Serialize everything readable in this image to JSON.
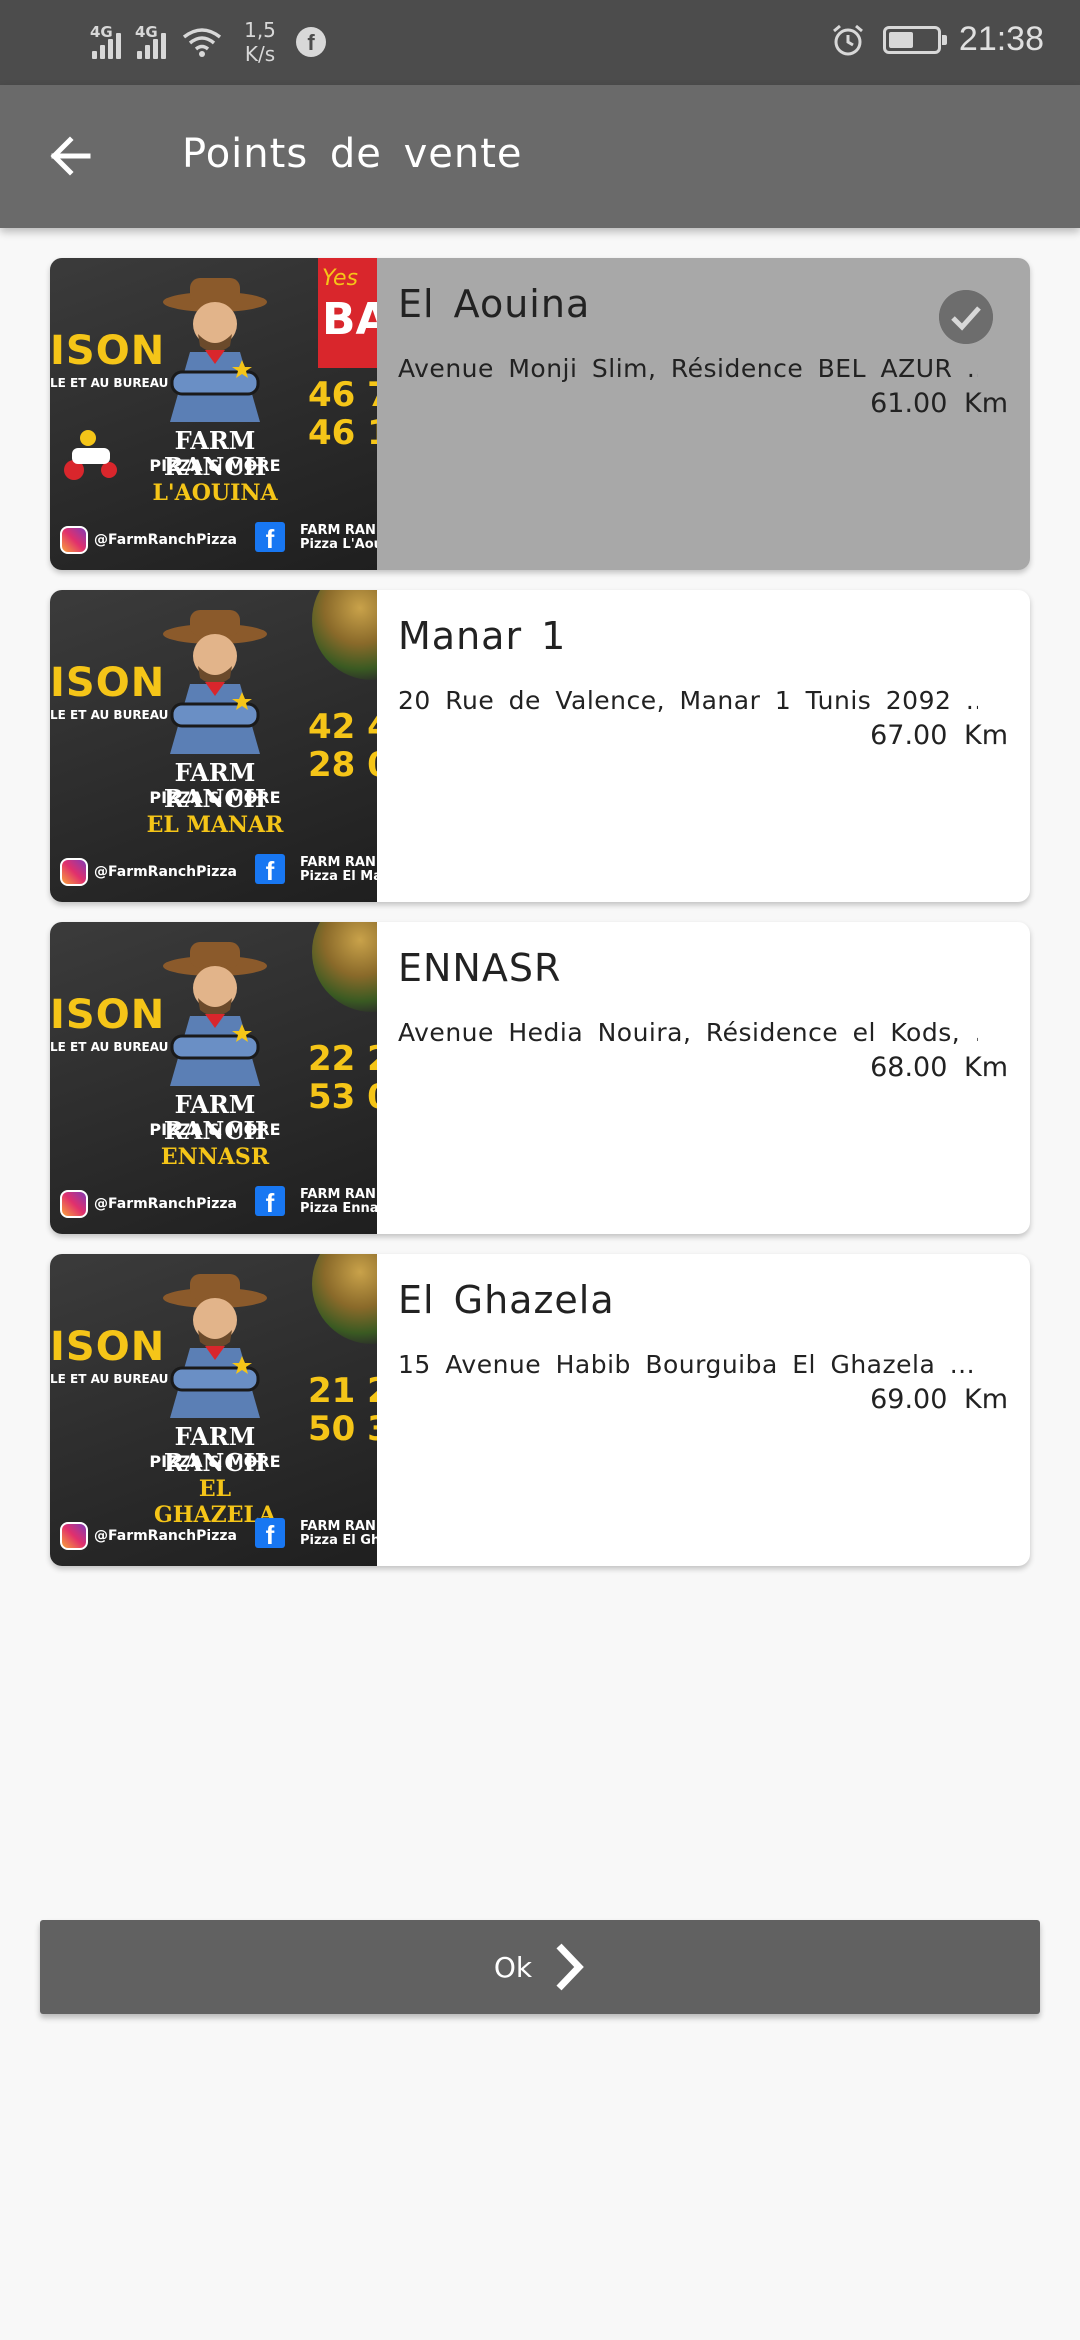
{
  "status_bar": {
    "network_1": "4G",
    "network_2": "4G",
    "speed_value": "1,5",
    "speed_unit": "K/s",
    "time": "21:38",
    "icons": [
      "signal-icon",
      "signal-icon",
      "wifi-icon",
      "facebook-icon",
      "alarm-icon",
      "battery-icon"
    ]
  },
  "appbar": {
    "title": "Points de vente",
    "back_icon": "arrow-left-icon"
  },
  "stores": [
    {
      "name": "El Aouina",
      "address": "Avenue Monji Slim, Résidence BEL AZUR ...",
      "distance": "61.00 Km",
      "selected": true,
      "thumb": {
        "left_word": "ISON",
        "left_sub": "LE ET AU BUREAU",
        "farm": "FARM RANCH",
        "pizza": "PIZZA & MORE",
        "branch": "L'AOUINA",
        "phone_1": "46 7",
        "phone_2": "46 1",
        "insta": "@FarmRanchPizza",
        "fb_1": "FARM RAN",
        "fb_2": "Pizza L'Aou",
        "banner_1": "Yes",
        "banner_2": "BA"
      }
    },
    {
      "name": "Manar 1",
      "address": "20 Rue de Valence, Manar 1 Tunis 2092 ...",
      "distance": "67.00 Km",
      "selected": false,
      "thumb": {
        "left_word": "ISON",
        "left_sub": "LE ET AU BUREAU",
        "farm": "FARM RANCH",
        "pizza": "PIZZA & MORE",
        "branch": "EL MANAR",
        "phone_1": "42 4",
        "phone_2": "28 0",
        "insta": "@FarmRanchPizza",
        "fb_1": "FARM RAN",
        "fb_2": "Pizza El Ma"
      }
    },
    {
      "name": "ENNASR",
      "address": "Avenue Hedia Nouira, Résidence el Kods, ...",
      "distance": "68.00 Km",
      "selected": false,
      "thumb": {
        "left_word": "ISON",
        "left_sub": "LE ET AU BUREAU",
        "farm": "FARM RANCH",
        "pizza": "PIZZA & MORE",
        "branch": "ENNASR",
        "phone_1": "22 2",
        "phone_2": "53 0",
        "insta": "@FarmRanchPizza",
        "fb_1": "FARM RAN",
        "fb_2": "Pizza Enna"
      }
    },
    {
      "name": "El Ghazela",
      "address": "15 Avenue Habib Bourguiba El Ghazela ...",
      "distance": "69.00 Km",
      "selected": false,
      "thumb": {
        "left_word": "ISON",
        "left_sub": "LE ET AU BUREAU",
        "farm": "FARM RANCH",
        "pizza": "PIZZA & MORE",
        "branch": "EL GHAZELA",
        "phone_1": "21 2",
        "phone_2": "50 3",
        "insta": "@FarmRanchPizza",
        "fb_1": "FARM RAN",
        "fb_2": "Pizza El Gh"
      }
    }
  ],
  "ok_button": {
    "label": "Ok",
    "icon": "chevron-right-icon"
  },
  "colors": {
    "status_bar": "#4c4c4c",
    "app_bar": "#6a6a6a",
    "selected_card": "#a8a8a8",
    "button": "#616161",
    "brand_yellow": "#f5c518"
  }
}
